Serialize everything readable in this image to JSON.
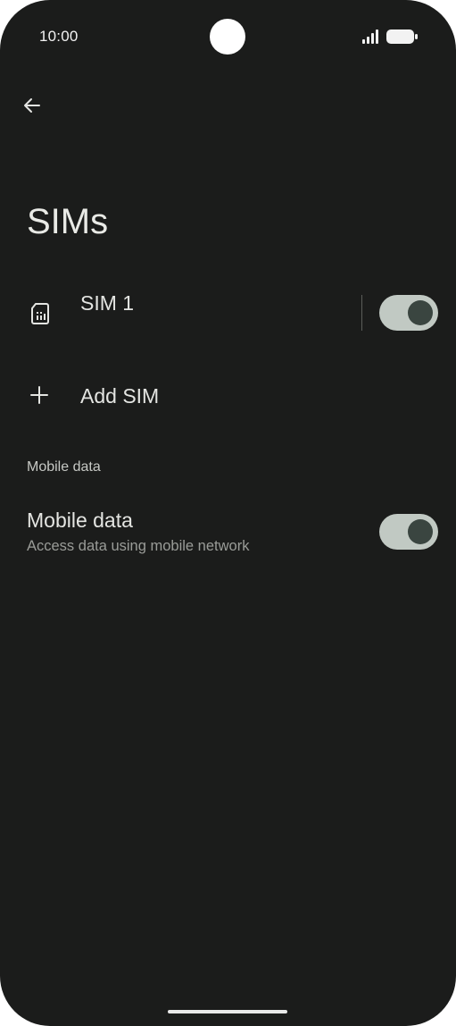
{
  "status_bar": {
    "time": "10:00",
    "icons": [
      "signal-icon",
      "battery-icon"
    ]
  },
  "header": {
    "back_icon": "arrow-back-icon",
    "title": "SIMs"
  },
  "sims": [
    {
      "label": "SIM 1",
      "icon": "sim-card-icon",
      "enabled": true
    }
  ],
  "add_sim": {
    "icon": "plus-icon",
    "label": "Add SIM"
  },
  "mobile_data_section": {
    "header": "Mobile data",
    "item": {
      "title": "Mobile data",
      "subtitle": "Access data using mobile network",
      "enabled": true
    }
  },
  "colors": {
    "background": "#1b1c1b",
    "text_primary": "#e4e5e2",
    "text_secondary": "#9a9c98",
    "toggle_track": "#c1c9c3",
    "toggle_knob": "#3a4540"
  }
}
